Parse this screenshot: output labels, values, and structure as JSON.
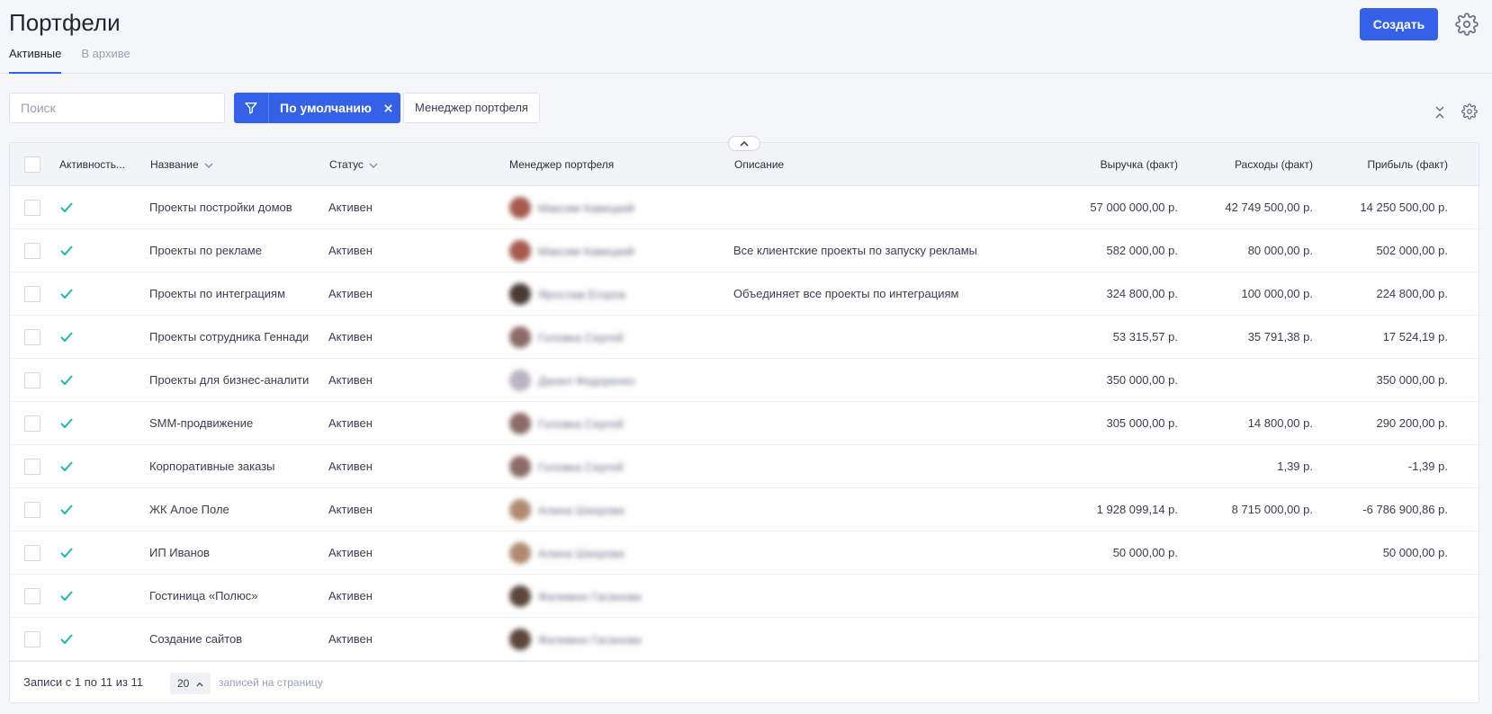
{
  "header": {
    "title": "Портфели",
    "tabs": [
      {
        "label": "Активные",
        "active": true
      },
      {
        "label": "В архиве",
        "active": false
      }
    ],
    "create_label": "Создать",
    "accent_color": "#3461e8"
  },
  "toolbar": {
    "search_placeholder": "Поиск",
    "filter_label": "По умолчанию",
    "manager_filter_label": "Менеджер портфеля"
  },
  "table": {
    "columns": {
      "activity": "Активность...",
      "name": "Название",
      "status": "Статус",
      "manager": "Менеджер портфеля",
      "description": "Описание",
      "revenue": "Выручка (факт)",
      "expenses": "Расходы (факт)",
      "profit": "Прибыль (факт)"
    },
    "rows": [
      {
        "active": true,
        "name": "Проекты постройки домов",
        "status": "Активен",
        "manager": "Максим Кавицкий",
        "avatar_color": "#a55a4c",
        "description": "",
        "revenue": "57 000 000,00 р.",
        "expenses": "42 749 500,00 р.",
        "profit": "14 250 500,00 р."
      },
      {
        "active": true,
        "name": "Проекты по рекламе",
        "status": "Активен",
        "manager": "Максим Кавицкий",
        "avatar_color": "#a55a4c",
        "description": "Все клиентские проекты по запуску рекламы",
        "revenue": "582 000,00 р.",
        "expenses": "80 000,00 р.",
        "profit": "502 000,00 р."
      },
      {
        "active": true,
        "name": "Проекты по интеграциям",
        "status": "Активен",
        "manager": "Ярослав Егоров",
        "avatar_color": "#4a3a36",
        "description": "Объединяет все проекты по интеграциям",
        "revenue": "324 800,00 р.",
        "expenses": "100 000,00 р.",
        "profit": "224 800,00 р."
      },
      {
        "active": true,
        "name": "Проекты сотрудника Геннадия",
        "status": "Активен",
        "manager": "Головка Сергей",
        "avatar_color": "#8a6c66",
        "description": "",
        "revenue": "53 315,57 р.",
        "expenses": "35 791,38 р.",
        "profit": "17 524,19 р."
      },
      {
        "active": true,
        "name": "Проекты для бизнес-аналитики",
        "status": "Активен",
        "manager": "Данил Федоренко",
        "avatar_color": "#b9b4c0",
        "description": "",
        "revenue": "350 000,00 р.",
        "expenses": "",
        "profit": "350 000,00 р."
      },
      {
        "active": true,
        "name": "SMM-продвижение",
        "status": "Активен",
        "manager": "Головка Сергей",
        "avatar_color": "#8a6c66",
        "description": "",
        "revenue": "305 000,00 р.",
        "expenses": "14 800,00 р.",
        "profit": "290 200,00 р."
      },
      {
        "active": true,
        "name": "Корпоративные заказы",
        "status": "Активен",
        "manager": "Головка Сергей",
        "avatar_color": "#8a6c66",
        "description": "",
        "revenue": "",
        "expenses": "1,39 р.",
        "profit": "-1,39 р."
      },
      {
        "active": true,
        "name": "ЖК Алое Поле",
        "status": "Активен",
        "manager": "Алина Шахрова",
        "avatar_color": "#b08a70",
        "description": "",
        "revenue": "1 928 099,14 р.",
        "expenses": "8 715 000,00 р.",
        "profit": "-6 786 900,86 р."
      },
      {
        "active": true,
        "name": "ИП Иванов",
        "status": "Активен",
        "manager": "Алина Шахрова",
        "avatar_color": "#b08a70",
        "description": "",
        "revenue": "50 000,00 р.",
        "expenses": "",
        "profit": "50 000,00 р."
      },
      {
        "active": true,
        "name": "Гостиница «Полюс»",
        "status": "Активен",
        "manager": "Филимон Гасанова",
        "avatar_color": "#5a463a",
        "description": "",
        "revenue": "",
        "expenses": "",
        "profit": ""
      },
      {
        "active": true,
        "name": "Создание сайтов",
        "status": "Активен",
        "manager": "Филимон Гасанова",
        "avatar_color": "#5a463a",
        "description": "",
        "revenue": "",
        "expenses": "",
        "profit": ""
      }
    ]
  },
  "footer": {
    "records_text": "Записи с 1 по 11 из 11",
    "page_size": "20",
    "page_size_label": "записей на страницу"
  },
  "icons": [
    "gear-icon",
    "filter-icon",
    "close-icon",
    "chevron-up-icon",
    "collapse-icon",
    "check-icon",
    "chevron-down-icon"
  ]
}
